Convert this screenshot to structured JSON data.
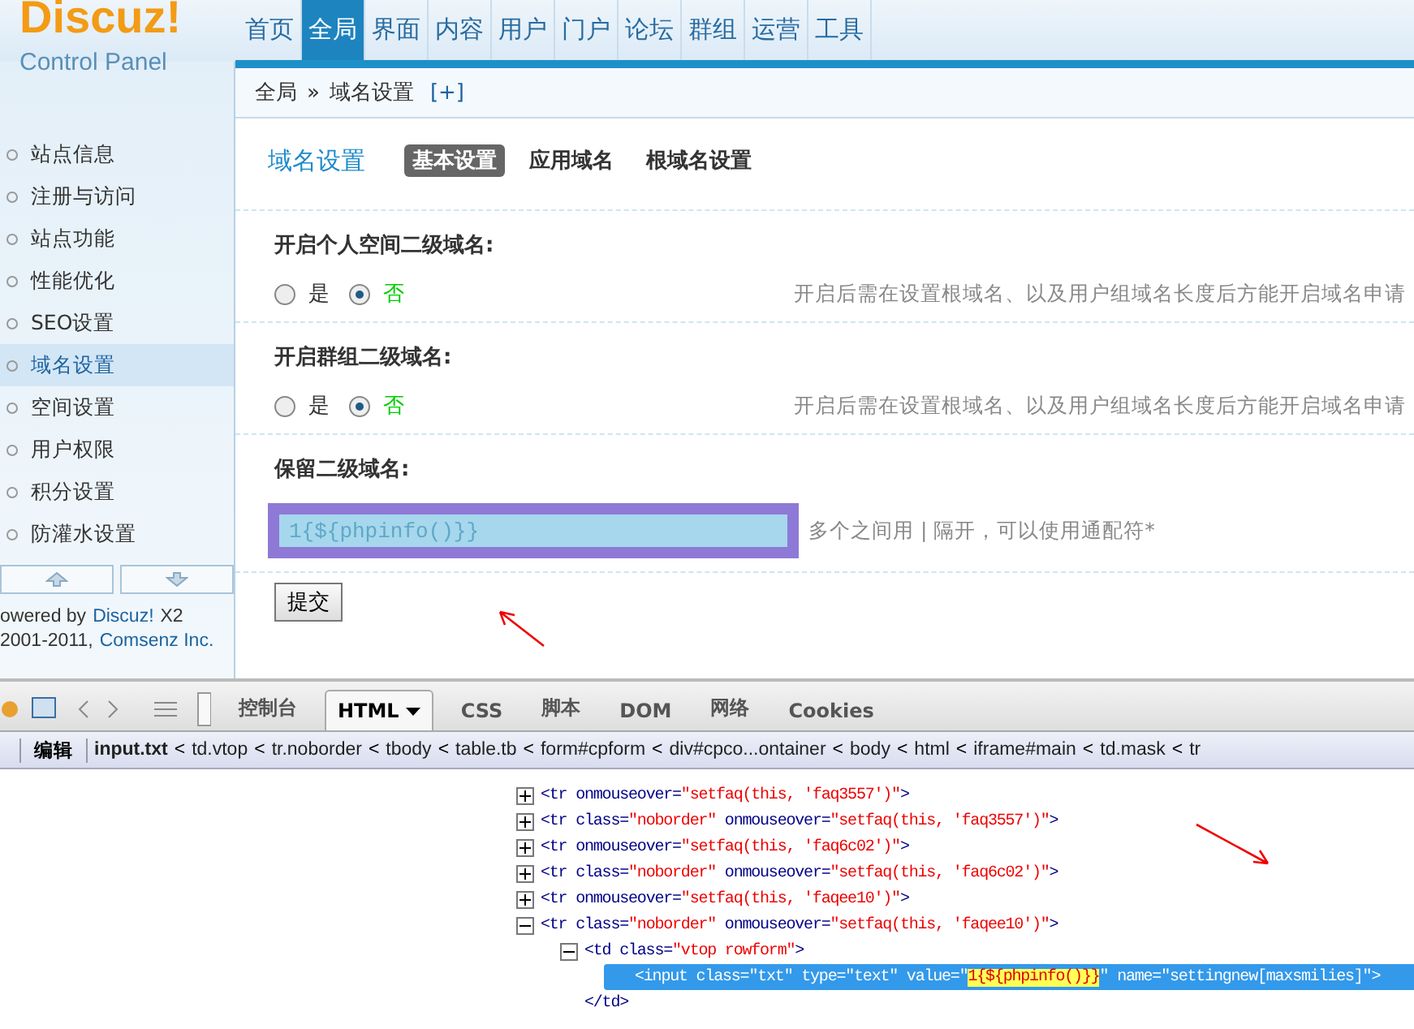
{
  "logo": {
    "brand": "Discuz!",
    "subtitle": "Control Panel"
  },
  "nav": [
    {
      "label": "首页",
      "selected": false
    },
    {
      "label": "全局",
      "selected": true
    },
    {
      "label": "界面",
      "selected": false
    },
    {
      "label": "内容",
      "selected": false
    },
    {
      "label": "用户",
      "selected": false
    },
    {
      "label": "门户",
      "selected": false
    },
    {
      "label": "论坛",
      "selected": false
    },
    {
      "label": "群组",
      "selected": false
    },
    {
      "label": "运营",
      "selected": false
    },
    {
      "label": "工具",
      "selected": false
    }
  ],
  "breadcrumb": {
    "items": [
      "全局",
      "域名设置"
    ],
    "separator": "»",
    "add": "[+]"
  },
  "sidebar": {
    "items": [
      {
        "label": "站点信息",
        "selected": false
      },
      {
        "label": "注册与访问",
        "selected": false
      },
      {
        "label": "站点功能",
        "selected": false
      },
      {
        "label": "性能优化",
        "selected": false
      },
      {
        "label": "SEO设置",
        "selected": false
      },
      {
        "label": "域名设置",
        "selected": true
      },
      {
        "label": "空间设置",
        "selected": false
      },
      {
        "label": "用户权限",
        "selected": false
      },
      {
        "label": "积分设置",
        "selected": false
      },
      {
        "label": "防灌水设置",
        "selected": false
      }
    ],
    "powered": {
      "prefix": "owered by",
      "link": "Discuz!",
      "suffix": "X2"
    },
    "copyright": {
      "prefix": "2001-2011,",
      "link": "Comsenz Inc."
    }
  },
  "page": {
    "title": "域名设置",
    "tabs": [
      {
        "label": "基本设置",
        "selected": true
      },
      {
        "label": "应用域名",
        "selected": false
      },
      {
        "label": "根域名设置",
        "selected": false
      }
    ]
  },
  "settings": [
    {
      "kind": "radio",
      "label": "开启个人空间二级域名:",
      "options": [
        {
          "label": "是",
          "selected": false
        },
        {
          "label": "否",
          "selected": true
        }
      ],
      "hint": "开启后需在设置根域名、以及用户组域名长度后方能开启域名申请"
    },
    {
      "kind": "radio",
      "label": "开启群组二级域名:",
      "options": [
        {
          "label": "是",
          "selected": false
        },
        {
          "label": "否",
          "selected": true
        }
      ],
      "hint": "开启后需在设置根域名、以及用户组域名长度后方能开启域名申请"
    },
    {
      "kind": "text",
      "label": "保留二级域名:",
      "value": "1{${phpinfo()}}",
      "hint": "多个之间用 | 隔开，可以使用通配符*"
    }
  ],
  "submit": "提交",
  "devtools": {
    "tabs": [
      {
        "label": "控制台",
        "selected": false
      },
      {
        "label": "HTML",
        "selected": true
      },
      {
        "label": "CSS",
        "selected": false
      },
      {
        "label": "脚本",
        "selected": false
      },
      {
        "label": "DOM",
        "selected": false
      },
      {
        "label": "网络",
        "selected": false
      },
      {
        "label": "Cookies",
        "selected": false
      }
    ],
    "edit": "编辑",
    "path": [
      {
        "kind": "item",
        "text": "input.txt",
        "selected": true
      },
      {
        "kind": "sep",
        "text": "<"
      },
      {
        "kind": "item",
        "text": "td.vtop",
        "selected": false
      },
      {
        "kind": "sep",
        "text": "<"
      },
      {
        "kind": "item",
        "text": "tr.noborder",
        "selected": false
      },
      {
        "kind": "sep",
        "text": "<"
      },
      {
        "kind": "item",
        "text": "tbody",
        "selected": false
      },
      {
        "kind": "sep",
        "text": "<"
      },
      {
        "kind": "item",
        "text": "table.tb",
        "selected": false
      },
      {
        "kind": "sep",
        "text": "<"
      },
      {
        "kind": "item",
        "text": "form#cpform",
        "selected": false
      },
      {
        "kind": "sep",
        "text": "<"
      },
      {
        "kind": "item",
        "text": "div#cpco...ontainer",
        "selected": false
      },
      {
        "kind": "sep",
        "text": "<"
      },
      {
        "kind": "item",
        "text": "body",
        "selected": false
      },
      {
        "kind": "sep",
        "text": "<"
      },
      {
        "kind": "item",
        "text": "html",
        "selected": false
      },
      {
        "kind": "sep",
        "text": "<"
      },
      {
        "kind": "item",
        "text": "iframe#main",
        "selected": false
      },
      {
        "kind": "sep",
        "text": "<"
      },
      {
        "kind": "item",
        "text": "td.mask",
        "selected": false
      },
      {
        "kind": "sep",
        "text": "<"
      },
      {
        "kind": "item",
        "text": "tr",
        "selected": false
      }
    ],
    "tree": [
      {
        "expanded": false,
        "selected": false,
        "parts": [
          {
            "kind": "tag",
            "text": "<tr "
          },
          {
            "kind": "attr",
            "text": "onmouseover="
          },
          {
            "kind": "value",
            "text": "\"setfaq(this, 'faq3557')\""
          },
          {
            "kind": "tag",
            "text": ">"
          }
        ]
      },
      {
        "expanded": false,
        "selected": false,
        "parts": [
          {
            "kind": "tag",
            "text": "<tr "
          },
          {
            "kind": "attr",
            "text": "class="
          },
          {
            "kind": "value",
            "text": "\"noborder\""
          },
          {
            "kind": "attr",
            "text": " onmouseover="
          },
          {
            "kind": "value",
            "text": "\"setfaq(this, 'faq3557')\""
          },
          {
            "kind": "tag",
            "text": ">"
          }
        ]
      },
      {
        "expanded": false,
        "selected": false,
        "parts": [
          {
            "kind": "tag",
            "text": "<tr "
          },
          {
            "kind": "attr",
            "text": "onmouseover="
          },
          {
            "kind": "value",
            "text": "\"setfaq(this, 'faq6c02')\""
          },
          {
            "kind": "tag",
            "text": ">"
          }
        ]
      },
      {
        "expanded": false,
        "selected": false,
        "parts": [
          {
            "kind": "tag",
            "text": "<tr "
          },
          {
            "kind": "attr",
            "text": "class="
          },
          {
            "kind": "value",
            "text": "\"noborder\""
          },
          {
            "kind": "attr",
            "text": " onmouseover="
          },
          {
            "kind": "value",
            "text": "\"setfaq(this, 'faq6c02')\""
          },
          {
            "kind": "tag",
            "text": ">"
          }
        ]
      },
      {
        "expanded": false,
        "selected": false,
        "parts": [
          {
            "kind": "tag",
            "text": "<tr "
          },
          {
            "kind": "attr",
            "text": "onmouseover="
          },
          {
            "kind": "value",
            "text": "\"setfaq(this, 'faqee10')\""
          },
          {
            "kind": "tag",
            "text": ">"
          }
        ]
      },
      {
        "expanded": true,
        "selected": false,
        "parts": [
          {
            "kind": "tag",
            "text": "<tr "
          },
          {
            "kind": "attr",
            "text": "class="
          },
          {
            "kind": "value",
            "text": "\"noborder\""
          },
          {
            "kind": "attr",
            "text": " onmouseover="
          },
          {
            "kind": "value",
            "text": "\"setfaq(this, 'faqee10')\""
          },
          {
            "kind": "tag",
            "text": ">"
          }
        ],
        "children": [
          {
            "expanded": true,
            "selected": false,
            "parts": [
              {
                "kind": "tag",
                "text": "<td "
              },
              {
                "kind": "attr",
                "text": "class="
              },
              {
                "kind": "value",
                "text": "\"vtop rowform\""
              },
              {
                "kind": "tag",
                "text": ">"
              }
            ],
            "children": [
              {
                "selected": true,
                "parts": [
                  {
                    "kind": "tag",
                    "text": "<input class=\"txt\" type=\"text\" value=\""
                  },
                  {
                    "kind": "highlight",
                    "text": "1{${phpinfo()}}"
                  },
                  {
                    "kind": "tag",
                    "text": "\" name=\"settingnew[maxsmilies]\">"
                  }
                ]
              }
            ]
          },
          {
            "selected": false,
            "parts": [
              {
                "kind": "tag",
                "text": "</td>"
              }
            ]
          }
        ]
      }
    ]
  }
}
